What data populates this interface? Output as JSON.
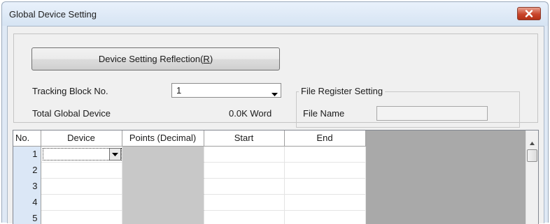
{
  "window": {
    "title": "Global Device Setting"
  },
  "reflection_button": {
    "label_prefix": "Device Setting Reflection(",
    "label_accel": "R",
    "label_suffix": ")"
  },
  "tracking_block": {
    "label": "Tracking Block No.",
    "value": "1"
  },
  "total_global_device": {
    "label": "Total Global Device",
    "value": "0.0K Word"
  },
  "file_register": {
    "legend": "File Register Setting",
    "file_name_label": "File Name",
    "file_name_value": ""
  },
  "grid": {
    "columns": [
      "No.",
      "Device",
      "Points (Decimal)",
      "Start",
      "End"
    ],
    "rows": [
      {
        "no": "1",
        "device": "",
        "points": "",
        "start": "",
        "end": ""
      },
      {
        "no": "2",
        "device": "",
        "points": "",
        "start": "",
        "end": ""
      },
      {
        "no": "3",
        "device": "",
        "points": "",
        "start": "",
        "end": ""
      },
      {
        "no": "4",
        "device": "",
        "points": "",
        "start": "",
        "end": ""
      },
      {
        "no": "5",
        "device": "",
        "points": "",
        "start": "",
        "end": ""
      }
    ]
  },
  "icons": {
    "close": "close-icon",
    "dropdown": "chevron-down-icon",
    "scroll_up": "scroll-up-arrow-icon"
  },
  "colors": {
    "close_button": "#c9452b",
    "row_number_bg": "#dbe7f6",
    "disabled_cell_bg": "#c8c8c8",
    "grid_empty_area": "#a9a9a9"
  }
}
